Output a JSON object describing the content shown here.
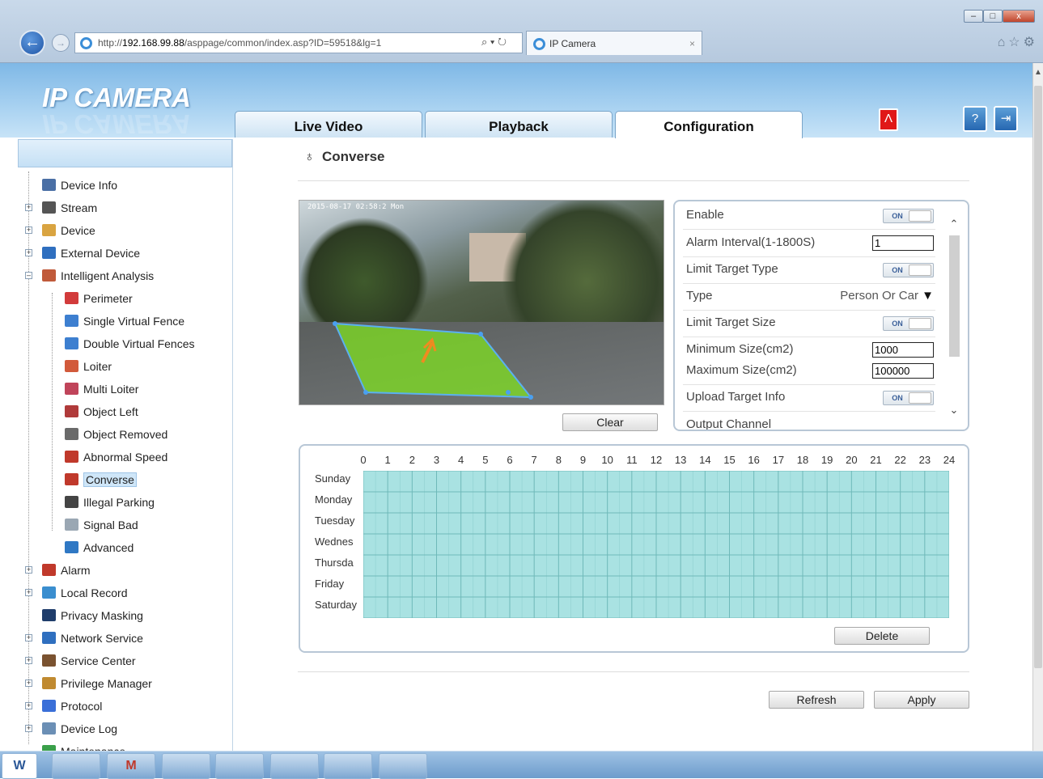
{
  "browser": {
    "url_prefix": "http://",
    "url_host": "192.168.99.88",
    "url_path": "/asppage/common/index.asp?ID=59518&lg=1",
    "addr_tools": "⌕ ▾ ↻",
    "tab_title": "IP Camera",
    "tab_close": "×",
    "win_min": "–",
    "win_max": "□",
    "win_close": "x",
    "back": "←",
    "forward": "→",
    "toolbar_icons": "⌂☆⚙"
  },
  "app": {
    "logo": "IP CAMERA",
    "tabs": [
      "Live Video",
      "Playback",
      "Configuration"
    ],
    "active_tab": "Configuration",
    "alarm_icon": "Ʌ",
    "help_icon": "?",
    "logout_icon": "⇥"
  },
  "sidebar": {
    "items": [
      {
        "label": "Device Info",
        "icon": "document-icon",
        "color": "#4a6fa5",
        "level": 0
      },
      {
        "label": "Stream",
        "icon": "film-icon",
        "color": "#555555",
        "level": 0,
        "expandable": true
      },
      {
        "label": "Device",
        "icon": "folder-gear-icon",
        "color": "#d9a441",
        "level": 0,
        "expandable": true
      },
      {
        "label": "External Device",
        "icon": "usb-icon",
        "color": "#2f6fbf",
        "level": 0,
        "expandable": true
      },
      {
        "label": "Intelligent Analysis",
        "icon": "person-analysis-icon",
        "color": "#c05a3a",
        "level": 0,
        "expanded": true
      },
      {
        "label": "Perimeter",
        "icon": "perimeter-icon",
        "color": "#d23b3b",
        "level": 1
      },
      {
        "label": "Single Virtual Fence",
        "icon": "single-fence-icon",
        "color": "#3d7fd0",
        "level": 1
      },
      {
        "label": "Double Virtual Fences",
        "icon": "double-fence-icon",
        "color": "#3d7fd0",
        "level": 1
      },
      {
        "label": "Loiter",
        "icon": "loiter-icon",
        "color": "#d25a3b",
        "level": 1
      },
      {
        "label": "Multi Loiter",
        "icon": "multi-loiter-icon",
        "color": "#c0445a",
        "level": 1
      },
      {
        "label": "Object Left",
        "icon": "object-left-icon",
        "color": "#b03a3a",
        "level": 1
      },
      {
        "label": "Object Removed",
        "icon": "object-removed-icon",
        "color": "#6a6a6a",
        "level": 1
      },
      {
        "label": "Abnormal Speed",
        "icon": "abnormal-speed-icon",
        "color": "#c0392b",
        "level": 1
      },
      {
        "label": "Converse",
        "icon": "converse-icon",
        "color": "#c0392b",
        "level": 1,
        "selected": true
      },
      {
        "label": "Illegal Parking",
        "icon": "car-icon",
        "color": "#444444",
        "level": 1
      },
      {
        "label": "Signal Bad",
        "icon": "signal-bad-icon",
        "color": "#9aa7b3",
        "level": 1
      },
      {
        "label": "Advanced",
        "icon": "advanced-icon",
        "color": "#2f78c4",
        "level": 1
      },
      {
        "label": "Alarm",
        "icon": "alarm-icon",
        "color": "#c0392b",
        "level": 0,
        "expandable": true
      },
      {
        "label": "Local Record",
        "icon": "local-record-icon",
        "color": "#3a8ecf",
        "level": 0,
        "expandable": true
      },
      {
        "label": "Privacy Masking",
        "icon": "monitor-icon",
        "color": "#1f3d6b",
        "level": 0
      },
      {
        "label": "Network Service",
        "icon": "network-icon",
        "color": "#2f6fbf",
        "level": 0,
        "expandable": true
      },
      {
        "label": "Service Center",
        "icon": "user-icon",
        "color": "#7a5230",
        "level": 0,
        "expandable": true
      },
      {
        "label": "Privilege Manager",
        "icon": "users-key-icon",
        "color": "#c08a30",
        "level": 0,
        "expandable": true
      },
      {
        "label": "Protocol",
        "icon": "protocol-icon",
        "color": "#3a6fd8",
        "level": 0,
        "expandable": true
      },
      {
        "label": "Device Log",
        "icon": "log-icon",
        "color": "#6b8fb5",
        "level": 0,
        "expandable": true
      },
      {
        "label": "Maintenance",
        "icon": "maintenance-icon",
        "color": "#3aa04a",
        "level": 0
      }
    ]
  },
  "page": {
    "title": "Converse",
    "title_icon": "♁"
  },
  "video": {
    "timestamp": "2015-08-17 02:58:2  Mon",
    "zone_color": "#7fe020"
  },
  "buttons": {
    "clear": "Clear",
    "delete": "Delete",
    "refresh": "Refresh",
    "apply": "Apply"
  },
  "settings": {
    "enable_label": "Enable",
    "enable_value": "ON",
    "alarm_interval_label": "Alarm Interval(1-1800S)",
    "alarm_interval_value": "1",
    "limit_target_type_label": "Limit Target Type",
    "limit_target_type_value": "ON",
    "type_label": "Type",
    "type_value": "Person Or Car",
    "limit_target_size_label": "Limit Target Size",
    "limit_target_size_value": "ON",
    "min_size_label": "Minimum Size(cm2)",
    "min_size_value": "1000",
    "max_size_label": "Maximum Size(cm2)",
    "max_size_value": "100000",
    "upload_target_info_label": "Upload Target Info",
    "upload_target_info_value": "ON",
    "output_channel_label": "Output Channel"
  },
  "schedule": {
    "hours": [
      "0",
      "1",
      "2",
      "3",
      "4",
      "5",
      "6",
      "7",
      "8",
      "9",
      "10",
      "11",
      "12",
      "13",
      "14",
      "15",
      "16",
      "17",
      "18",
      "19",
      "20",
      "21",
      "22",
      "23",
      "24"
    ],
    "days": [
      "Sunday",
      "Monday",
      "Tuesday",
      "Wednes",
      "Thursda",
      "Friday",
      "Saturday"
    ],
    "fill_color": "#a9e2e2"
  },
  "taskbar": {
    "items": [
      "W",
      "",
      "M",
      "",
      "",
      "",
      "",
      ""
    ]
  }
}
